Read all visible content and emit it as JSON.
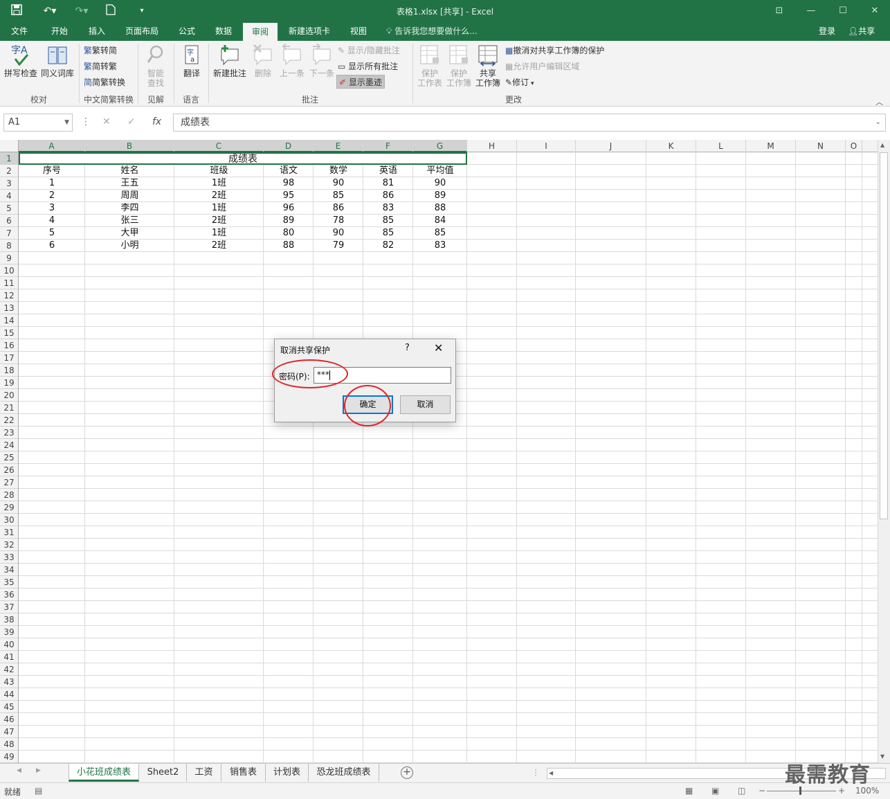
{
  "window": {
    "title": "表格1.xlsx  [共享] - Excel",
    "brand_color": "#217346"
  },
  "menu_tabs": [
    "文件",
    "开始",
    "插入",
    "页面布局",
    "公式",
    "数据",
    "审阅",
    "新建选项卡",
    "视图"
  ],
  "active_tab": "审阅",
  "tellme_placeholder": "告诉我您想要做什么...",
  "account": {
    "login": "登录",
    "share": "共享"
  },
  "ribbon": {
    "proofing": {
      "spell": "拼写检查",
      "thesaurus": "同义词库",
      "group": "校对"
    },
    "chinese": {
      "t2s": "繁转简",
      "s2t": "简转繁",
      "convert": "简繁转换",
      "group": "中文简繁转换"
    },
    "insights": {
      "smart_line1": "智能",
      "smart_line2": "查找",
      "group": "见解"
    },
    "language": {
      "translate": "翻译",
      "group": "语言"
    },
    "comments": {
      "new": "新建批注",
      "delete": "删除",
      "prev": "上一条",
      "next": "下一条",
      "showhide": "显示/隐藏批注",
      "showall": "显示所有批注",
      "ink": "显示墨迹",
      "group": "批注"
    },
    "changes": {
      "protect_sheet_1": "保护",
      "protect_sheet_2": "工作表",
      "protect_wb_1": "保护",
      "protect_wb_2": "工作簿",
      "share_wb_1": "共享",
      "share_wb_2": "工作簿",
      "unprotect_shared": "撤消对共享工作簿的保护",
      "allow_edit": "允许用户编辑区域",
      "track": "修订",
      "group": "更改"
    }
  },
  "formula_bar": {
    "name_box": "A1",
    "value": "成绩表",
    "fx": "fx"
  },
  "grid": {
    "columns": [
      "A",
      "B",
      "C",
      "D",
      "E",
      "F",
      "G",
      "H",
      "I",
      "J",
      "K",
      "L",
      "M",
      "N",
      "O"
    ],
    "rows": [
      "1",
      "2",
      "3",
      "4",
      "5",
      "6",
      "7",
      "8",
      "9",
      "10",
      "11",
      "12",
      "13",
      "14",
      "15",
      "16",
      "17",
      "18",
      "19",
      "20",
      "21",
      "22",
      "23",
      "24",
      "25",
      "26",
      "27",
      "28",
      "29",
      "30",
      "31",
      "32",
      "33",
      "34",
      "35",
      "36",
      "37",
      "38",
      "39",
      "40",
      "41",
      "42",
      "43",
      "44",
      "45",
      "46",
      "47",
      "48",
      "49"
    ],
    "title_cell": "成绩表",
    "header": [
      "序号",
      "姓名",
      "班级",
      "语文",
      "数学",
      "英语",
      "平均值"
    ],
    "data": [
      [
        "1",
        "王五",
        "1班",
        "98",
        "90",
        "81",
        "90"
      ],
      [
        "2",
        "周周",
        "2班",
        "95",
        "85",
        "86",
        "89"
      ],
      [
        "3",
        "李四",
        "1班",
        "96",
        "86",
        "83",
        "88"
      ],
      [
        "4",
        "张三",
        "2班",
        "89",
        "78",
        "85",
        "84"
      ],
      [
        "5",
        "大甲",
        "1班",
        "80",
        "90",
        "85",
        "85"
      ],
      [
        "6",
        "小明",
        "2班",
        "88",
        "79",
        "82",
        "83"
      ]
    ]
  },
  "sheets": [
    "小花班成绩表",
    "Sheet2",
    "工资",
    "销售表",
    "计划表",
    "恐龙班成绩表"
  ],
  "active_sheet": "小花班成绩表",
  "status": {
    "ready": "就绪",
    "zoom": "100%"
  },
  "watermark": "最需教育",
  "dialog": {
    "title": "取消共享保护",
    "help": "?",
    "close": "✕",
    "password_label": "密码(P):",
    "password_value": "***",
    "ok": "确定",
    "cancel": "取消",
    "highlight_color": "#e0242a"
  }
}
